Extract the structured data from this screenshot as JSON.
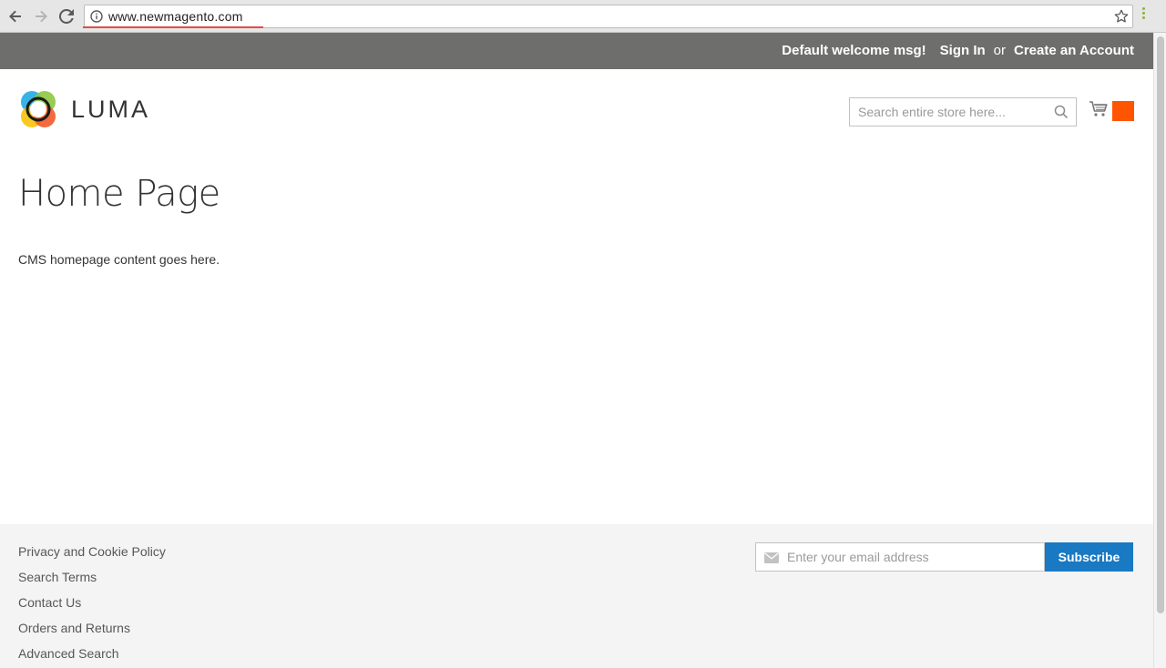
{
  "browser": {
    "url": "www.newmagento.com",
    "icons": [
      "back-arrow-icon",
      "forward-arrow-icon",
      "reload-icon",
      "info-icon",
      "star-icon",
      "menu-kebab-icon"
    ]
  },
  "panel": {
    "welcome": "Default welcome msg!",
    "sign_in": "Sign In",
    "or": "or",
    "create_account": "Create an Account"
  },
  "header": {
    "logo_text": "LUMA",
    "search_placeholder": "Search entire store here...",
    "cart_counter_color": "#ff5501"
  },
  "main": {
    "title": "Home Page",
    "content": "CMS homepage content goes here."
  },
  "footer": {
    "links": [
      "Privacy and Cookie Policy",
      "Search Terms",
      "Contact Us",
      "Orders and Returns",
      "Advanced Search"
    ],
    "newsletter_placeholder": "Enter your email address",
    "subscribe_label": "Subscribe",
    "subscribe_color": "#1979c3"
  }
}
